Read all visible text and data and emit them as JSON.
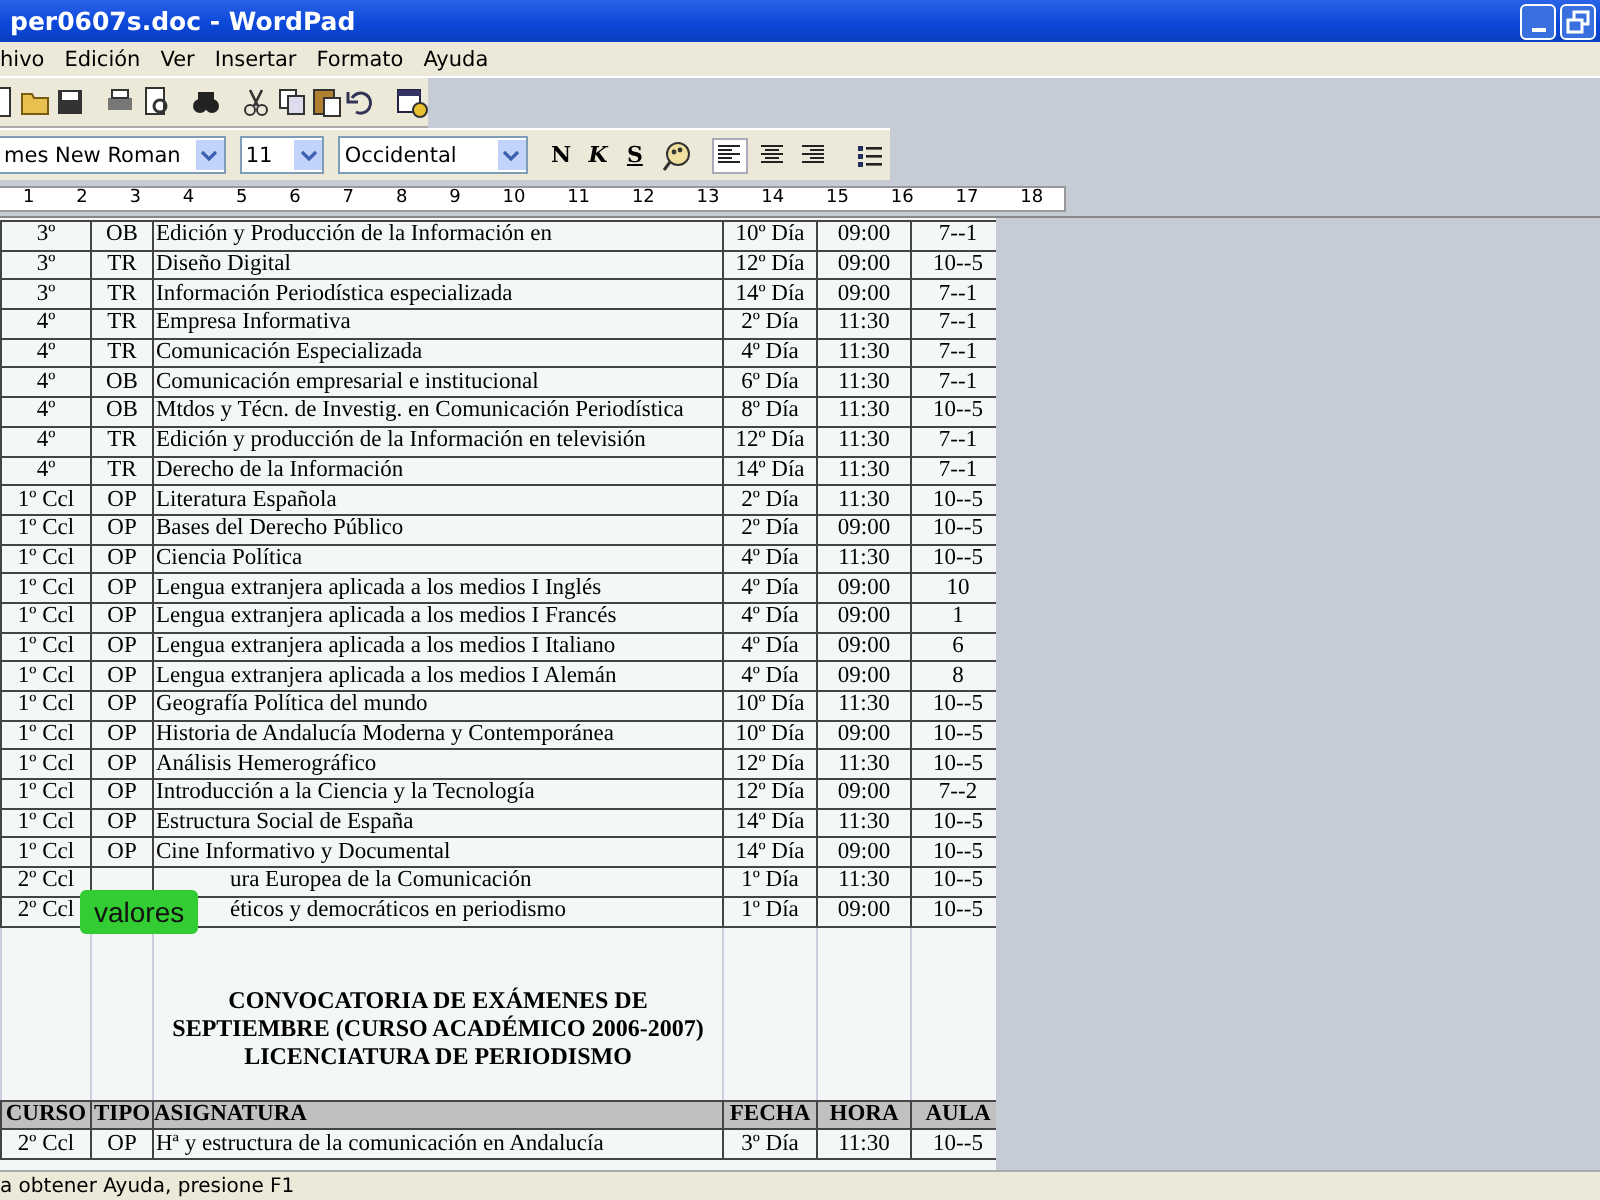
{
  "window": {
    "title": "per0607s.doc - WordPad"
  },
  "menu": [
    "hivo",
    "Edición",
    "Ver",
    "Insertar",
    "Formato",
    "Ayuda"
  ],
  "format_bar": {
    "font": "mes New Roman",
    "size": "11",
    "script": "Occidental",
    "bold": "N",
    "italic": "K",
    "underline": "S",
    "align": [
      {
        "kind": "left",
        "selected": true
      },
      {
        "kind": "center",
        "selected": false
      },
      {
        "kind": "right",
        "selected": false
      }
    ]
  },
  "ruler": [
    "1",
    "2",
    "3",
    "4",
    "5",
    "6",
    "7",
    "8",
    "9",
    "10",
    "11",
    "12",
    "13",
    "14",
    "15",
    "16",
    "17",
    "18"
  ],
  "table1": {
    "rows": [
      [
        "3º",
        "OB",
        "Edición y Producción de la Información en",
        "10º Día",
        "09:00",
        "7--1"
      ],
      [
        "3º",
        "TR",
        "Diseño Digital",
        "12º Día",
        "09:00",
        "10--5"
      ],
      [
        "3º",
        "TR",
        "Información Periodística especializada",
        "14º Día",
        "09:00",
        "7--1"
      ],
      [
        "4º",
        "TR",
        "Empresa Informativa",
        "2º Día",
        "11:30",
        "7--1"
      ],
      [
        "4º",
        "TR",
        "Comunicación Especializada",
        "4º Día",
        "11:30",
        "7--1"
      ],
      [
        "4º",
        "OB",
        "Comunicación empresarial e institucional",
        "6º Día",
        "11:30",
        "7--1"
      ],
      [
        "4º",
        "OB",
        "Mtdos y Técn. de Investig. en Comunicación Periodística",
        "8º Día",
        "11:30",
        "10--5"
      ],
      [
        "4º",
        "TR",
        "Edición y producción de la Información en televisión",
        "12º Día",
        "11:30",
        "7--1"
      ],
      [
        "4º",
        "TR",
        "Derecho de la Información",
        "14º Día",
        "11:30",
        "7--1"
      ],
      [
        "1º Ccl",
        "OP",
        "Literatura Española",
        "2º Día",
        "11:30",
        "10--5"
      ],
      [
        "1º Ccl",
        "OP",
        "Bases del Derecho Público",
        "2º Día",
        "09:00",
        "10--5"
      ],
      [
        "1º Ccl",
        "OP",
        "Ciencia Política",
        "4º Día",
        "11:30",
        "10--5"
      ],
      [
        "1º Ccl",
        "OP",
        "Lengua extranjera aplicada a los medios I Inglés",
        "4º Día",
        "09:00",
        "10"
      ],
      [
        "1º Ccl",
        "OP",
        "Lengua extranjera aplicada a los medios I Francés",
        "4º Día",
        "09:00",
        "1"
      ],
      [
        "1º Ccl",
        "OP",
        "Lengua extranjera aplicada a los medios I Italiano",
        "4º Día",
        "09:00",
        "6"
      ],
      [
        "1º Ccl",
        "OP",
        "Lengua extranjera aplicada a los medios I Alemán",
        "4º Día",
        "09:00",
        "8"
      ],
      [
        "1º Ccl",
        "OP",
        "Geografía Política del mundo",
        "10º Día",
        "11:30",
        "10--5"
      ],
      [
        "1º Ccl",
        "OP",
        "Historia de Andalucía Moderna y Contemporánea",
        "10º Día",
        "09:00",
        "10--5"
      ],
      [
        "1º Ccl",
        "OP",
        "Análisis Hemerográfico",
        "12º Día",
        "11:30",
        "10--5"
      ],
      [
        "1º Ccl",
        "OP",
        "Introducción a la Ciencia y la Tecnología",
        "12º Día",
        "09:00",
        "7--2"
      ],
      [
        "1º Ccl",
        "OP",
        "Estructura Social de España",
        "14º Día",
        "11:30",
        "10--5"
      ],
      [
        "1º Ccl",
        "OP",
        "Cine Informativo y Documental",
        "14º Día",
        "09:00",
        "10--5"
      ],
      [
        "2º Ccl",
        "",
        "ura Europea de la Comunicación",
        "1º Día",
        "11:30",
        "10--5"
      ],
      [
        "2º Ccl",
        "",
        "éticos y democráticos en periodismo",
        "1º Día",
        "09:00",
        "10--5"
      ]
    ]
  },
  "overlay_label": "valores",
  "heading": [
    "CONVOCATORIA DE EXÁMENES DE",
    "SEPTIEMBRE (CURSO ACADÉMICO 2006-2007)",
    "LICENCIATURA DE PERIODISMO"
  ],
  "table2": {
    "columns": [
      "CURSO",
      "TIPO",
      "ASIGNATURA",
      "FECHA",
      "HORA",
      "AULA"
    ],
    "rows": [
      [
        "2º Ccl",
        "OP",
        "Hª y estructura de la comunicación en Andalucía",
        "3º Día",
        "11:30",
        "10--5"
      ]
    ]
  },
  "status_bar": "a obtener Ayuda, presione F1"
}
